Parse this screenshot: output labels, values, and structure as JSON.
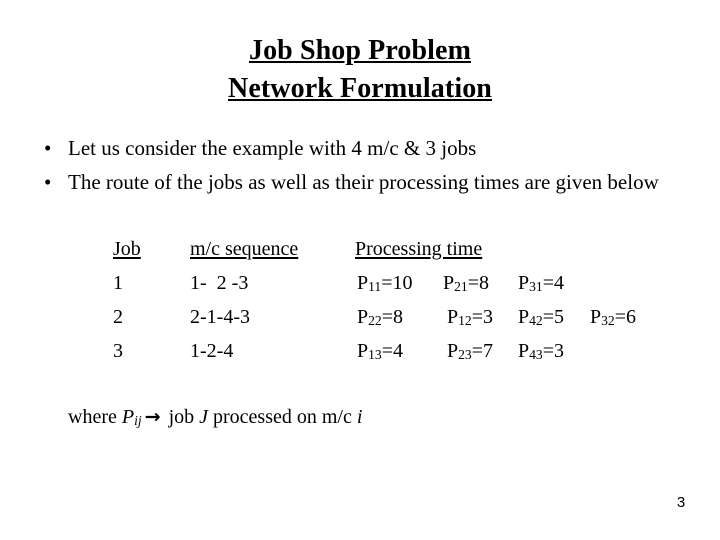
{
  "slide": {
    "page_number": "3",
    "background_color": "#ffffff",
    "text_color": "#000000"
  },
  "title": {
    "line1": "Job Shop Problem",
    "line2": "Network Formulation"
  },
  "bullets": [
    {
      "marker": "•",
      "text": "Let us consider the example with 4 m/c & 3 jobs"
    },
    {
      "marker": "•",
      "text": "The route of the jobs as well as their processing times are given below"
    }
  ],
  "table": {
    "headers": {
      "job": "Job",
      "sequence": "m/c sequence",
      "processing": "Processing time"
    },
    "rows": [
      {
        "job": "1",
        "sequence": "1-  2 -3",
        "processing": [
          {
            "symbol": "P",
            "sub": "11",
            "eq": "=",
            "value": "10"
          },
          {
            "symbol": "P",
            "sub": "21",
            "eq": "=",
            "value": "8"
          },
          {
            "symbol": "P",
            "sub": "31",
            "eq": "=",
            "value": "4"
          }
        ]
      },
      {
        "job": "2",
        "sequence": "2-1-4-3",
        "processing": [
          {
            "symbol": "P",
            "sub": "22",
            "eq": "=",
            "value": "8"
          },
          {
            "symbol": "P",
            "sub": "12",
            "eq": "=",
            "value": "3"
          },
          {
            "symbol": "P",
            "sub": "42",
            "eq": "=",
            "value": "5"
          },
          {
            "symbol": "P",
            "sub": "32",
            "eq": "=",
            "value": "6"
          }
        ]
      },
      {
        "job": "3",
        "sequence": "1-2-4",
        "processing": [
          {
            "symbol": "P",
            "sub": "13",
            "eq": "=",
            "value": "4"
          },
          {
            "symbol": "P",
            "sub": "23",
            "eq": "=",
            "value": "7"
          },
          {
            "symbol": "P",
            "sub": "43",
            "eq": "=",
            "value": "3"
          }
        ]
      }
    ]
  },
  "note": {
    "prefix": "where ",
    "symbol": "P",
    "symbol_sub": "ij",
    "arrow": "→",
    "middle": " job ",
    "job_var": "J",
    "suffix": " processed on m/c ",
    "machine_var": "i"
  }
}
